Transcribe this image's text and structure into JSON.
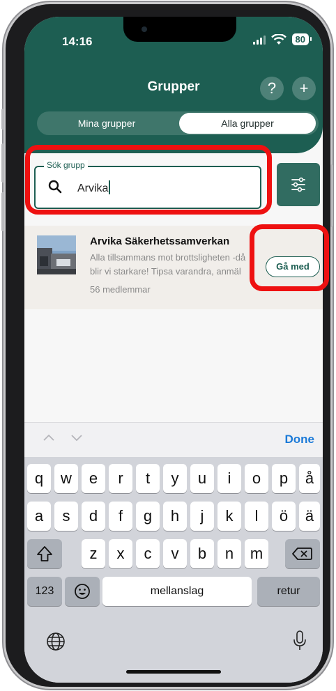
{
  "status": {
    "time": "14:16",
    "battery": "80"
  },
  "header": {
    "title": "Grupper",
    "help_label": "?",
    "add_label": "+",
    "tabs": [
      {
        "label": "Mina grupper"
      },
      {
        "label": "Alla grupper"
      }
    ]
  },
  "search": {
    "legend": "Sök grupp",
    "value": "Arvika"
  },
  "result": {
    "title": "Arvika Säkerhetssamverkan",
    "description_line1": "Alla tillsammans mot brottsligheten -då",
    "description_line2": "blir vi starkare! Tipsa varandra, anmäl",
    "members": "56 medlemmar",
    "join_label": "Gå med"
  },
  "keyboard": {
    "done_label": "Done",
    "row1": [
      "q",
      "w",
      "e",
      "r",
      "t",
      "y",
      "u",
      "i",
      "o",
      "p",
      "å"
    ],
    "row2": [
      "a",
      "s",
      "d",
      "f",
      "g",
      "h",
      "j",
      "k",
      "l",
      "ö",
      "ä"
    ],
    "row3": [
      "z",
      "x",
      "c",
      "v",
      "b",
      "n",
      "m"
    ],
    "numbers_label": "123",
    "space_label": "mellanslag",
    "return_label": "retur"
  },
  "colors": {
    "primary": "#1d5e52",
    "highlight": "#ee1111",
    "link": "#1b7ad8"
  }
}
